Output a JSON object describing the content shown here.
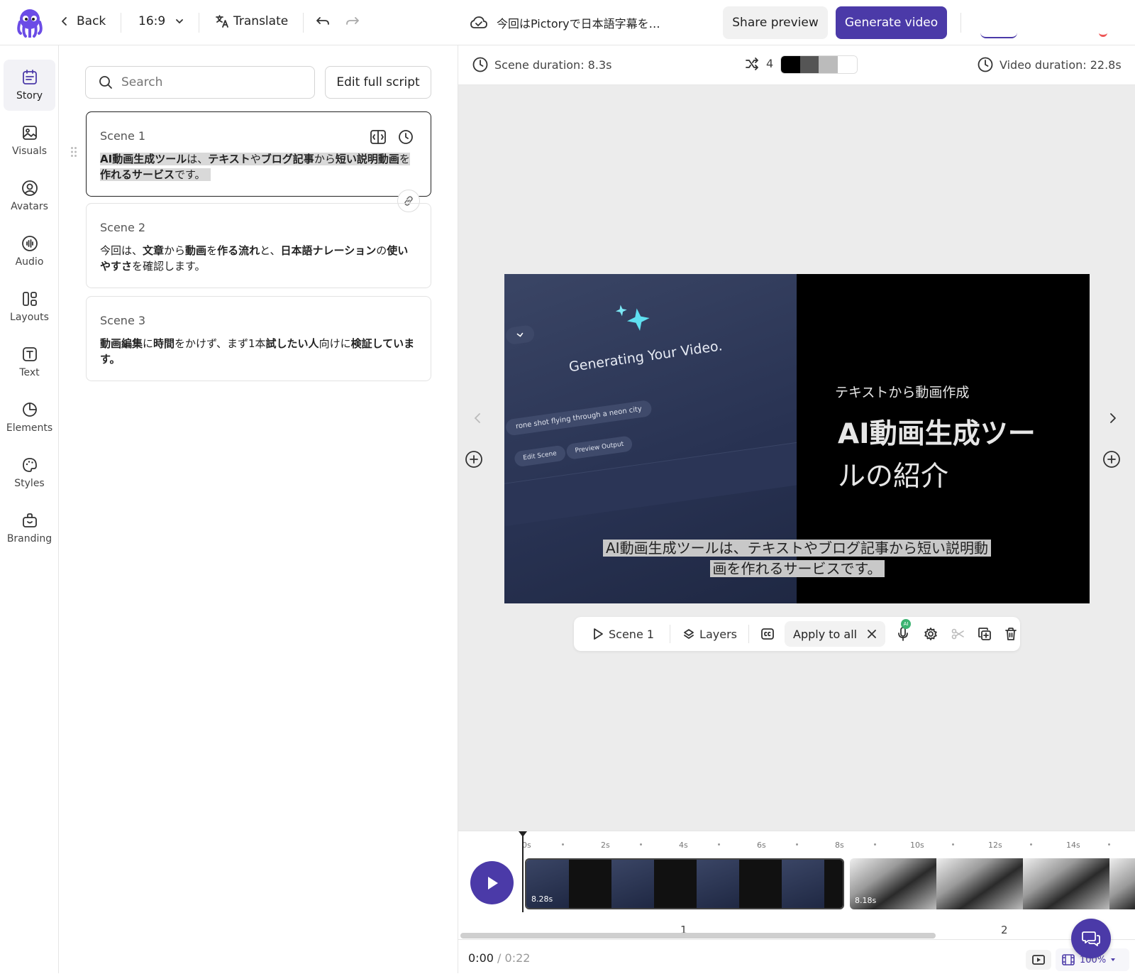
{
  "topbar": {
    "back_label": "Back",
    "aspect_ratio": "16:9",
    "translate_label": "Translate",
    "project_title": "今回はPictoryで日本語字幕を…",
    "share_preview_label": "Share preview",
    "generate_video_label": "Generate video"
  },
  "rail": {
    "items": [
      {
        "label": "Story",
        "icon": "story-icon",
        "active": true
      },
      {
        "label": "Visuals",
        "icon": "image-icon"
      },
      {
        "label": "Avatars",
        "icon": "avatar-icon"
      },
      {
        "label": "Audio",
        "icon": "audio-icon"
      },
      {
        "label": "Layouts",
        "icon": "layout-icon"
      },
      {
        "label": "Text",
        "icon": "text-icon"
      },
      {
        "label": "Elements",
        "icon": "elements-icon"
      },
      {
        "label": "Styles",
        "icon": "palette-icon"
      },
      {
        "label": "Branding",
        "icon": "briefcase-icon"
      }
    ]
  },
  "story": {
    "search_placeholder": "Search",
    "edit_full_script_label": "Edit full script",
    "scenes": [
      {
        "label": "Scene 1",
        "parts": [
          {
            "t": "AI動画生成ツール",
            "b": true
          },
          {
            "t": "は、",
            "b": false
          },
          {
            "t": "テキスト",
            "b": true
          },
          {
            "t": "や",
            "b": false
          },
          {
            "t": "ブログ記事",
            "b": true
          },
          {
            "t": "から",
            "b": false
          },
          {
            "t": "短い説明動画",
            "b": true
          },
          {
            "t": "を",
            "b": false
          },
          {
            "t": "作れるサービス",
            "b": true
          },
          {
            "t": "です。",
            "b": false
          }
        ]
      },
      {
        "label": "Scene 2",
        "parts": [
          {
            "t": "今回は、",
            "b": false
          },
          {
            "t": "文章",
            "b": true
          },
          {
            "t": "から",
            "b": false
          },
          {
            "t": "動画",
            "b": true
          },
          {
            "t": "を",
            "b": false
          },
          {
            "t": "作る流れ",
            "b": true
          },
          {
            "t": "と、",
            "b": false
          },
          {
            "t": "日本語ナレーション",
            "b": true
          },
          {
            "t": "の",
            "b": false
          },
          {
            "t": "使いやすさ",
            "b": true
          },
          {
            "t": "を確認します。",
            "b": false
          }
        ]
      },
      {
        "label": "Scene 3",
        "parts": [
          {
            "t": "動画編集",
            "b": true
          },
          {
            "t": "に",
            "b": false
          },
          {
            "t": "時間",
            "b": true
          },
          {
            "t": "をかけず、まず1本",
            "b": false
          },
          {
            "t": "試したい人",
            "b": true
          },
          {
            "t": "向けに",
            "b": false
          },
          {
            "t": "検証しています。",
            "b": true
          }
        ]
      }
    ]
  },
  "infobar": {
    "scene_duration": "Scene duration: 8.3s",
    "shuffle_count": "4",
    "video_duration": "Video duration: 22.8s"
  },
  "video": {
    "mock_title": "Generating Your Video.",
    "mock_prompt": "rone shot flying through a neon city",
    "mock_btn_1": "Edit Scene",
    "mock_btn_2": "Preview Output",
    "subtitle_small": "テキストから動画作成",
    "title_line_1": "AI動画生成ツー",
    "title_line_2": "ルの紹介",
    "caption_line_1": "AI動画生成ツールは、テキストやブログ記事から短い説明動",
    "caption_line_2": "画を作れるサービスです。"
  },
  "scene_toolbar": {
    "scene_label": "Scene 1",
    "layers_label": "Layers",
    "apply_all_label": "Apply to all",
    "ai_badge": "AI"
  },
  "timeline": {
    "ticks": [
      "0s",
      "2s",
      "4s",
      "6s",
      "8s",
      "10s",
      "12s",
      "14s"
    ],
    "clips": [
      {
        "number": "1",
        "duration": "8.28s"
      },
      {
        "number": "2",
        "duration": "8.18s"
      }
    ],
    "current_time": "0:00",
    "separator": "/",
    "total_time": "0:22",
    "zoom": "100%"
  }
}
